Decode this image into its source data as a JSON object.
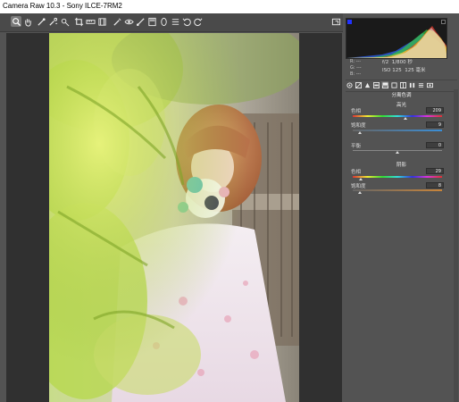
{
  "window": {
    "title": "Camera Raw 10.3 -  Sony ILCE-7RM2"
  },
  "toolbar": {
    "tools": [
      "zoom-tool-icon",
      "hand-tool-icon",
      "white-balance-icon",
      "color-sampler-icon",
      "targeted-adjustment-icon",
      "crop-icon",
      "straighten-icon",
      "transform-icon",
      "spot-removal-icon",
      "red-eye-icon",
      "adjustment-brush-icon",
      "graduated-filter-icon",
      "radial-filter-icon",
      "preferences-icon",
      "rotate-ccw-icon",
      "rotate-cw-icon"
    ],
    "fullscreen_icon": "fullscreen-icon"
  },
  "info": {
    "rgb": [
      "R:",
      "G:",
      "B:"
    ],
    "rgb_values": [
      "---",
      "---",
      "---"
    ],
    "aperture": "f/2",
    "shutter": "1/800 秒",
    "iso": "ISO 125",
    "focal": "125 毫米"
  },
  "panel": {
    "tabs": [
      "basic",
      "tone-curve",
      "detail",
      "hsl",
      "split-toning",
      "lens",
      "effects",
      "calibration",
      "presets",
      "snapshots"
    ],
    "active_tab": 4,
    "title": "分离色调",
    "highlights": {
      "header": "高光",
      "hue_label": "色相",
      "hue_value": "209",
      "sat_label": "饱和度",
      "sat_value": "9"
    },
    "balance": {
      "label": "平衡",
      "value": "0"
    },
    "shadows": {
      "header": "阴影",
      "hue_label": "色相",
      "hue_value": "29",
      "sat_label": "饱和度",
      "sat_value": "8"
    }
  },
  "colors": {
    "accent_thumb": "#dddddd",
    "panel_bg": "#535353",
    "canvas_bg": "#303030"
  }
}
